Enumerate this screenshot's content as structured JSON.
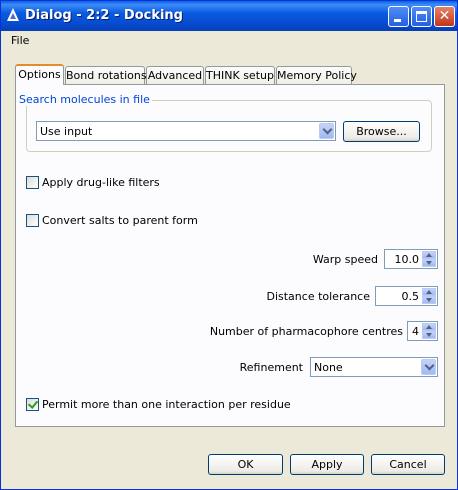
{
  "window": {
    "title": "Dialog - 2:2 - Docking"
  },
  "menubar": {
    "file": "File"
  },
  "tabs": [
    {
      "label": "Options"
    },
    {
      "label": "Bond rotations"
    },
    {
      "label": "Advanced"
    },
    {
      "label": "THINK setup"
    },
    {
      "label": "Memory Policy"
    }
  ],
  "search": {
    "group_title": "Search molecules in file",
    "source_value": "Use input",
    "browse_label": "Browse..."
  },
  "options": {
    "drug_like_label": "Apply drug-like filters",
    "drug_like_checked": false,
    "salts_label": "Convert salts to parent form",
    "salts_checked": false,
    "warp_label": "Warp speed",
    "warp_value": "10.0",
    "distance_label": "Distance tolerance",
    "distance_value": "0.5",
    "pharm_label": "Number of pharmacophore centres",
    "pharm_value": "4",
    "refinement_label": "Refinement",
    "refinement_value": "None",
    "permit_label": "Permit more than one interaction per residue",
    "permit_checked": true
  },
  "buttons": {
    "ok": "OK",
    "apply": "Apply",
    "cancel": "Cancel"
  },
  "colors": {
    "titlebar": "#0a5be0",
    "active_tab_accent": "#e68b2c",
    "group_title": "#0046d5",
    "check": "#21a121"
  }
}
